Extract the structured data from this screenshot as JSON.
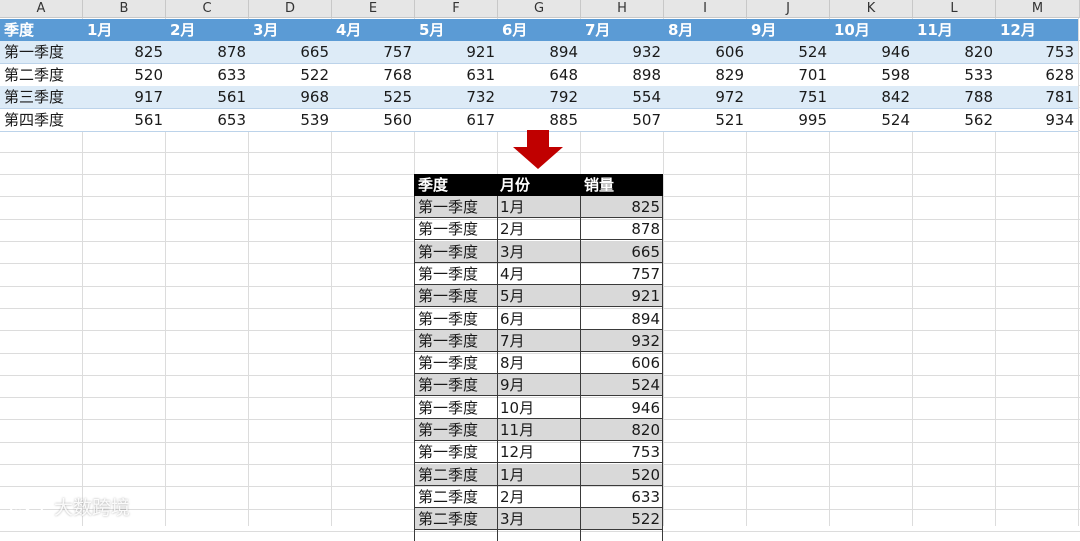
{
  "columns": [
    "A",
    "B",
    "C",
    "D",
    "E",
    "F",
    "G",
    "H",
    "I",
    "J",
    "K",
    "L",
    "M"
  ],
  "source": {
    "header": [
      "季度",
      "1月",
      "2月",
      "3月",
      "4月",
      "5月",
      "6月",
      "7月",
      "8月",
      "9月",
      "10月",
      "11月",
      "12月"
    ],
    "rows": [
      {
        "label": "第一季度",
        "values": [
          825,
          878,
          665,
          757,
          921,
          894,
          932,
          606,
          524,
          946,
          820,
          753
        ]
      },
      {
        "label": "第二季度",
        "values": [
          520,
          633,
          522,
          768,
          631,
          648,
          898,
          829,
          701,
          598,
          533,
          628
        ]
      },
      {
        "label": "第三季度",
        "values": [
          917,
          561,
          968,
          525,
          732,
          792,
          554,
          972,
          751,
          842,
          788,
          781
        ]
      },
      {
        "label": "第四季度",
        "values": [
          561,
          653,
          539,
          560,
          617,
          885,
          507,
          521,
          995,
          524,
          562,
          934
        ]
      }
    ]
  },
  "result": {
    "header": [
      "季度",
      "月份",
      "销量"
    ],
    "rows": [
      [
        "第一季度",
        "1月",
        "825"
      ],
      [
        "第一季度",
        "2月",
        "878"
      ],
      [
        "第一季度",
        "3月",
        "665"
      ],
      [
        "第一季度",
        "4月",
        "757"
      ],
      [
        "第一季度",
        "5月",
        "921"
      ],
      [
        "第一季度",
        "6月",
        "894"
      ],
      [
        "第一季度",
        "7月",
        "932"
      ],
      [
        "第一季度",
        "8月",
        "606"
      ],
      [
        "第一季度",
        "9月",
        "524"
      ],
      [
        "第一季度",
        "10月",
        "946"
      ],
      [
        "第一季度",
        "11月",
        "820"
      ],
      [
        "第一季度",
        "12月",
        "753"
      ],
      [
        "第二季度",
        "1月",
        "520"
      ],
      [
        "第二季度",
        "2月",
        "633"
      ],
      [
        "第二季度",
        "3月",
        "522"
      ]
    ]
  },
  "watermark": "大数跨境",
  "colors": {
    "header_blue": "#5b9bd5",
    "band_light": "#ddebf7",
    "arrow_red": "#c00000",
    "result_shade": "#d9d9d9"
  },
  "icons": {
    "arrow": "down-arrow-icon",
    "watermark_logo": "chat-bubble-logo-icon"
  }
}
